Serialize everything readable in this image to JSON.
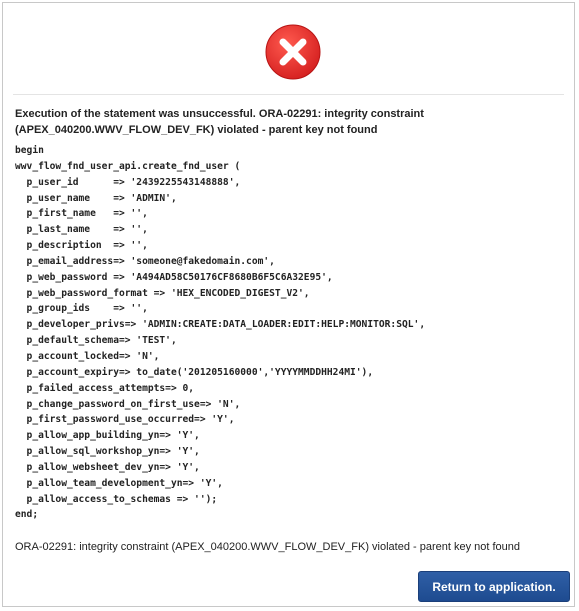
{
  "icon": {
    "name": "error-x-icon",
    "color": "#e02a2a"
  },
  "error_title": "Execution of the statement was unsuccessful. ORA-02291: integrity constraint (APEX_040200.WWV_FLOW_DEV_FK) violated - parent key not found",
  "code": "begin\nwwv_flow_fnd_user_api.create_fnd_user (\n  p_user_id      => '2439225543148888',\n  p_user_name    => 'ADMIN',\n  p_first_name   => '',\n  p_last_name    => '',\n  p_description  => '',\n  p_email_address=> 'someone@fakedomain.com',\n  p_web_password => 'A494AD58C50176CF8680B6F5C6A32E95',\n  p_web_password_format => 'HEX_ENCODED_DIGEST_V2',\n  p_group_ids    => '',\n  p_developer_privs=> 'ADMIN:CREATE:DATA_LOADER:EDIT:HELP:MONITOR:SQL',\n  p_default_schema=> 'TEST',\n  p_account_locked=> 'N',\n  p_account_expiry=> to_date('201205160000','YYYYMMDDHH24MI'),\n  p_failed_access_attempts=> 0,\n  p_change_password_on_first_use=> 'N',\n  p_first_password_use_occurred=> 'Y',\n  p_allow_app_building_yn=> 'Y',\n  p_allow_sql_workshop_yn=> 'Y',\n  p_allow_websheet_dev_yn=> 'Y',\n  p_allow_team_development_yn=> 'Y',\n  p_allow_access_to_schemas => '');\nend;",
  "error_message": "ORA-02291: integrity constraint (APEX_040200.WWV_FLOW_DEV_FK) violated - parent key not found",
  "return_button_label": "Return to application."
}
